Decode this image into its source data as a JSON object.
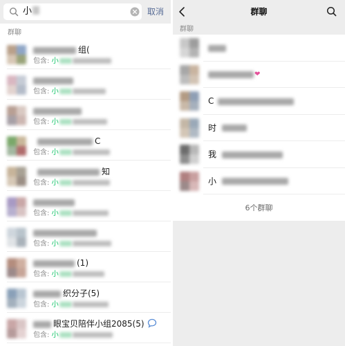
{
  "search": {
    "query": "小",
    "cancel_label": "取消",
    "section_label": "群聊"
  },
  "results": [
    {
      "title": "组(",
      "sub_prefix": "包含: ",
      "sub_hl": "小",
      "avatar_colors": [
        "#b9a08a",
        "#8fa6c7",
        "#d7c7b5",
        "#9aa47a"
      ],
      "icon": null
    },
    {
      "title": "",
      "sub_prefix": "包含: ",
      "sub_hl": "小",
      "avatar_colors": [
        "#d9b7c1",
        "#c6ccd6",
        "#e2d3cf",
        "#b4bcc9"
      ],
      "icon": null
    },
    {
      "title": "",
      "sub_prefix": "包含: ",
      "sub_hl": "小",
      "avatar_colors": [
        "#b89f94",
        "#d9c9c2",
        "#a7a0a6",
        "#cdb7b2"
      ],
      "icon": null
    },
    {
      "title": "C",
      "sub_prefix": "包含: ",
      "sub_hl": "小",
      "avatar_colors": [
        "#7aa86a",
        "#c9b79a",
        "#a3b8a0",
        "#b06d6d"
      ],
      "icon": null
    },
    {
      "title": "知",
      "sub_prefix": "包含: ",
      "sub_hl": "小",
      "avatar_colors": [
        "#c7b49a",
        "#a8a194",
        "#d6c8b6",
        "#9b8f85"
      ],
      "icon": null
    },
    {
      "title": "",
      "sub_prefix": "包含: ",
      "sub_hl": "小",
      "avatar_colors": [
        "#a89ac4",
        "#c9a7a7",
        "#b7b0cf",
        "#d8c3c3"
      ],
      "icon": null
    },
    {
      "title": "",
      "sub_prefix": "包含: ",
      "sub_hl": "小",
      "avatar_colors": [
        "#cfd6dd",
        "#b9c4cc",
        "#e0e3e6",
        "#a9b2ba"
      ],
      "icon": null
    },
    {
      "title": "(1)",
      "sub_prefix": "包含: ",
      "sub_hl": "小",
      "avatar_colors": [
        "#b48d7e",
        "#d0b0a1",
        "#9c8a8a",
        "#c7a598"
      ],
      "icon": null
    },
    {
      "title": "织分子(5)",
      "sub_prefix": "包含: ",
      "sub_hl": "小",
      "avatar_colors": [
        "#8aa0b8",
        "#b9c6d2",
        "#a3b0bd",
        "#ccd5dd"
      ],
      "icon": null
    },
    {
      "title": "眼宝贝陪伴小组2085(5)",
      "sub_prefix": "包含: ",
      "sub_hl": "小",
      "avatar_colors": [
        "#c9a6a6",
        "#dac6c6",
        "#b69b9b",
        "#e4d2d2"
      ],
      "icon": "chat-bubble"
    }
  ],
  "groups": {
    "nav_title": "群聊",
    "section_label": "群聊",
    "items": [
      {
        "name": "",
        "avatar_colors": [
          "#c8c8c8",
          "#9d9d9d",
          "#d6d6d6",
          "#b3b3b3"
        ]
      },
      {
        "name": "",
        "avatar_colors": [
          "#a7a7a7",
          "#c9b4a0",
          "#bdbdbd",
          "#d2c3b4"
        ]
      },
      {
        "name": "C",
        "avatar_colors": [
          "#b39b84",
          "#8f9fb5",
          "#c9b9a8",
          "#a6b0bd"
        ]
      },
      {
        "name": "时",
        "avatar_colors": [
          "#c4b7a6",
          "#9aa9b8",
          "#d3c6b6",
          "#b0bac4"
        ]
      },
      {
        "name": "我",
        "avatar_colors": [
          "#6c6c6c",
          "#b8b8b8",
          "#8e8e8e",
          "#d0d0d0"
        ]
      },
      {
        "name": "小",
        "avatar_colors": [
          "#b08080",
          "#c9a0a0",
          "#9c8a8a",
          "#d8b8b8"
        ]
      }
    ],
    "count_label": "6个群聊"
  },
  "colors": {
    "highlight_green": "#07c160",
    "link_blue": "#576b95",
    "panel_gray": "#ededed"
  }
}
